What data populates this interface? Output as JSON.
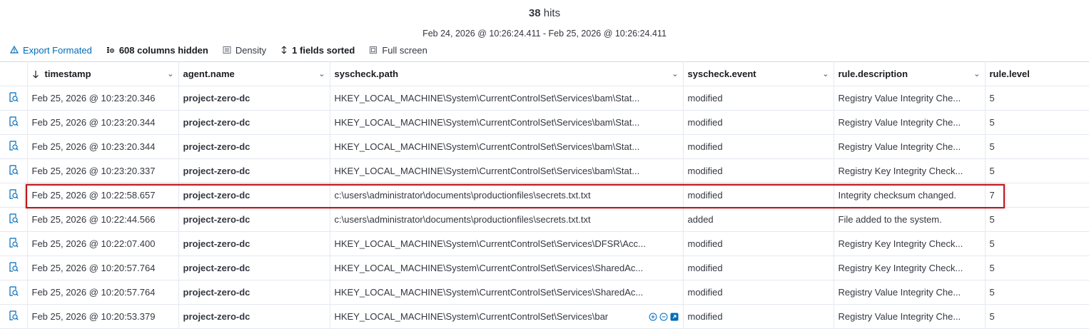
{
  "summary": {
    "hits_count": "38",
    "hits_label": "hits",
    "time_range": "Feb 24, 2026 @ 10:26:24.411 - Feb 25, 2026 @ 10:26:24.411"
  },
  "toolbar": {
    "export_label": "Export Formated",
    "columns_hidden_label": "608 columns hidden",
    "density_label": "Density",
    "fields_sorted_label": "1 fields sorted",
    "full_screen_label": "Full screen"
  },
  "columns": {
    "timestamp": "timestamp",
    "agent_name": "agent.name",
    "syscheck_path": "syscheck.path",
    "syscheck_event": "syscheck.event",
    "rule_description": "rule.description",
    "rule_level": "rule.level"
  },
  "rows": [
    {
      "timestamp": "Feb 25, 2026 @ 10:23:20.346",
      "agent": "project-zero-dc",
      "path": "HKEY_LOCAL_MACHINE\\System\\CurrentControlSet\\Services\\bam\\Stat...",
      "event": "modified",
      "description": "Registry Value Integrity Che...",
      "level": "5"
    },
    {
      "timestamp": "Feb 25, 2026 @ 10:23:20.344",
      "agent": "project-zero-dc",
      "path": "HKEY_LOCAL_MACHINE\\System\\CurrentControlSet\\Services\\bam\\Stat...",
      "event": "modified",
      "description": "Registry Value Integrity Che...",
      "level": "5"
    },
    {
      "timestamp": "Feb 25, 2026 @ 10:23:20.344",
      "agent": "project-zero-dc",
      "path": "HKEY_LOCAL_MACHINE\\System\\CurrentControlSet\\Services\\bam\\Stat...",
      "event": "modified",
      "description": "Registry Value Integrity Che...",
      "level": "5"
    },
    {
      "timestamp": "Feb 25, 2026 @ 10:23:20.337",
      "agent": "project-zero-dc",
      "path": "HKEY_LOCAL_MACHINE\\System\\CurrentControlSet\\Services\\bam\\Stat...",
      "event": "modified",
      "description": "Registry Key Integrity Check...",
      "level": "5"
    },
    {
      "timestamp": "Feb 25, 2026 @ 10:22:58.657",
      "agent": "project-zero-dc",
      "path": "c:\\users\\administrator\\documents\\productionfiles\\secrets.txt.txt",
      "event": "modified",
      "description": "Integrity checksum changed.",
      "level": "7"
    },
    {
      "timestamp": "Feb 25, 2026 @ 10:22:44.566",
      "agent": "project-zero-dc",
      "path": "c:\\users\\administrator\\documents\\productionfiles\\secrets.txt.txt",
      "event": "added",
      "description": "File added to the system.",
      "level": "5"
    },
    {
      "timestamp": "Feb 25, 2026 @ 10:22:07.400",
      "agent": "project-zero-dc",
      "path": "HKEY_LOCAL_MACHINE\\System\\CurrentControlSet\\Services\\DFSR\\Acc...",
      "event": "modified",
      "description": "Registry Key Integrity Check...",
      "level": "5"
    },
    {
      "timestamp": "Feb 25, 2026 @ 10:20:57.764",
      "agent": "project-zero-dc",
      "path": "HKEY_LOCAL_MACHINE\\System\\CurrentControlSet\\Services\\SharedAc...",
      "event": "modified",
      "description": "Registry Key Integrity Check...",
      "level": "5"
    },
    {
      "timestamp": "Feb 25, 2026 @ 10:20:57.764",
      "agent": "project-zero-dc",
      "path": "HKEY_LOCAL_MACHINE\\System\\CurrentControlSet\\Services\\SharedAc...",
      "event": "modified",
      "description": "Registry Value Integrity Che...",
      "level": "5"
    },
    {
      "timestamp": "Feb 25, 2026 @ 10:20:53.379",
      "agent": "project-zero-dc",
      "path": "HKEY_LOCAL_MACHINE\\System\\CurrentControlSet\\Services\\bar",
      "event": "modified",
      "description": "Registry Value Integrity Che...",
      "level": "5"
    }
  ],
  "highlighted_row_index": 4,
  "colors": {
    "link_blue": "#006bb8",
    "highlight_red": "#c4161c",
    "grid_border": "#e3e8f2"
  },
  "icons": {
    "export": "export-icon",
    "columns": "columns-hidden-icon",
    "density": "density-icon",
    "sort": "sort-icon",
    "fullscreen": "fullscreen-icon",
    "expand": "expand-row-icon"
  }
}
